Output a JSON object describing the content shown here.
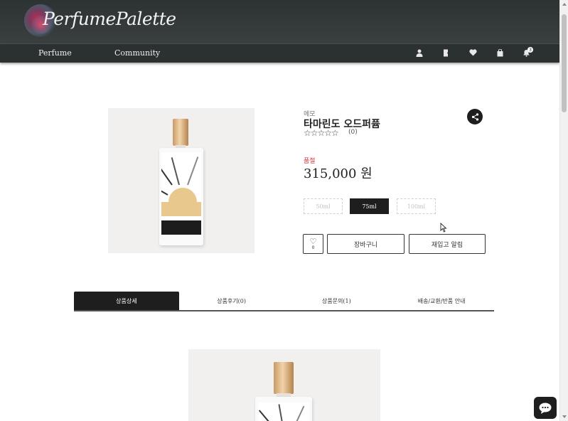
{
  "header": {
    "logo_text": "PerfumePalette",
    "nav": {
      "perfume": "Perfume",
      "community": "Community"
    },
    "icons": [
      "user-icon",
      "logout-icon",
      "heart-icon",
      "shopping-bag-icon",
      "bell-icon"
    ],
    "notification_count": "3"
  },
  "product": {
    "brand": "메모",
    "name": "타마린도 오드퍼퓸",
    "rating_stars": "☆☆☆☆☆",
    "review_count": "(0)",
    "status": "품절",
    "price": "315,000 원",
    "options": [
      {
        "label": "50ml",
        "state": "disabled"
      },
      {
        "label": "75ml",
        "state": "selected"
      },
      {
        "label": "100ml",
        "state": "disabled"
      }
    ],
    "like_count": "0",
    "cart_button": "장바구니",
    "restock_button": "재입고 알림"
  },
  "tabs": [
    {
      "label": "상품상세",
      "active": true
    },
    {
      "label": "상품후기(0)",
      "active": false
    },
    {
      "label": "상품문의(1)",
      "active": false
    },
    {
      "label": "배송/교환/반품 안내",
      "active": false
    }
  ],
  "colors": {
    "header_bg": "#2d3232",
    "accent_dark": "#1e1e1e",
    "soldout": "#d23b3b"
  }
}
